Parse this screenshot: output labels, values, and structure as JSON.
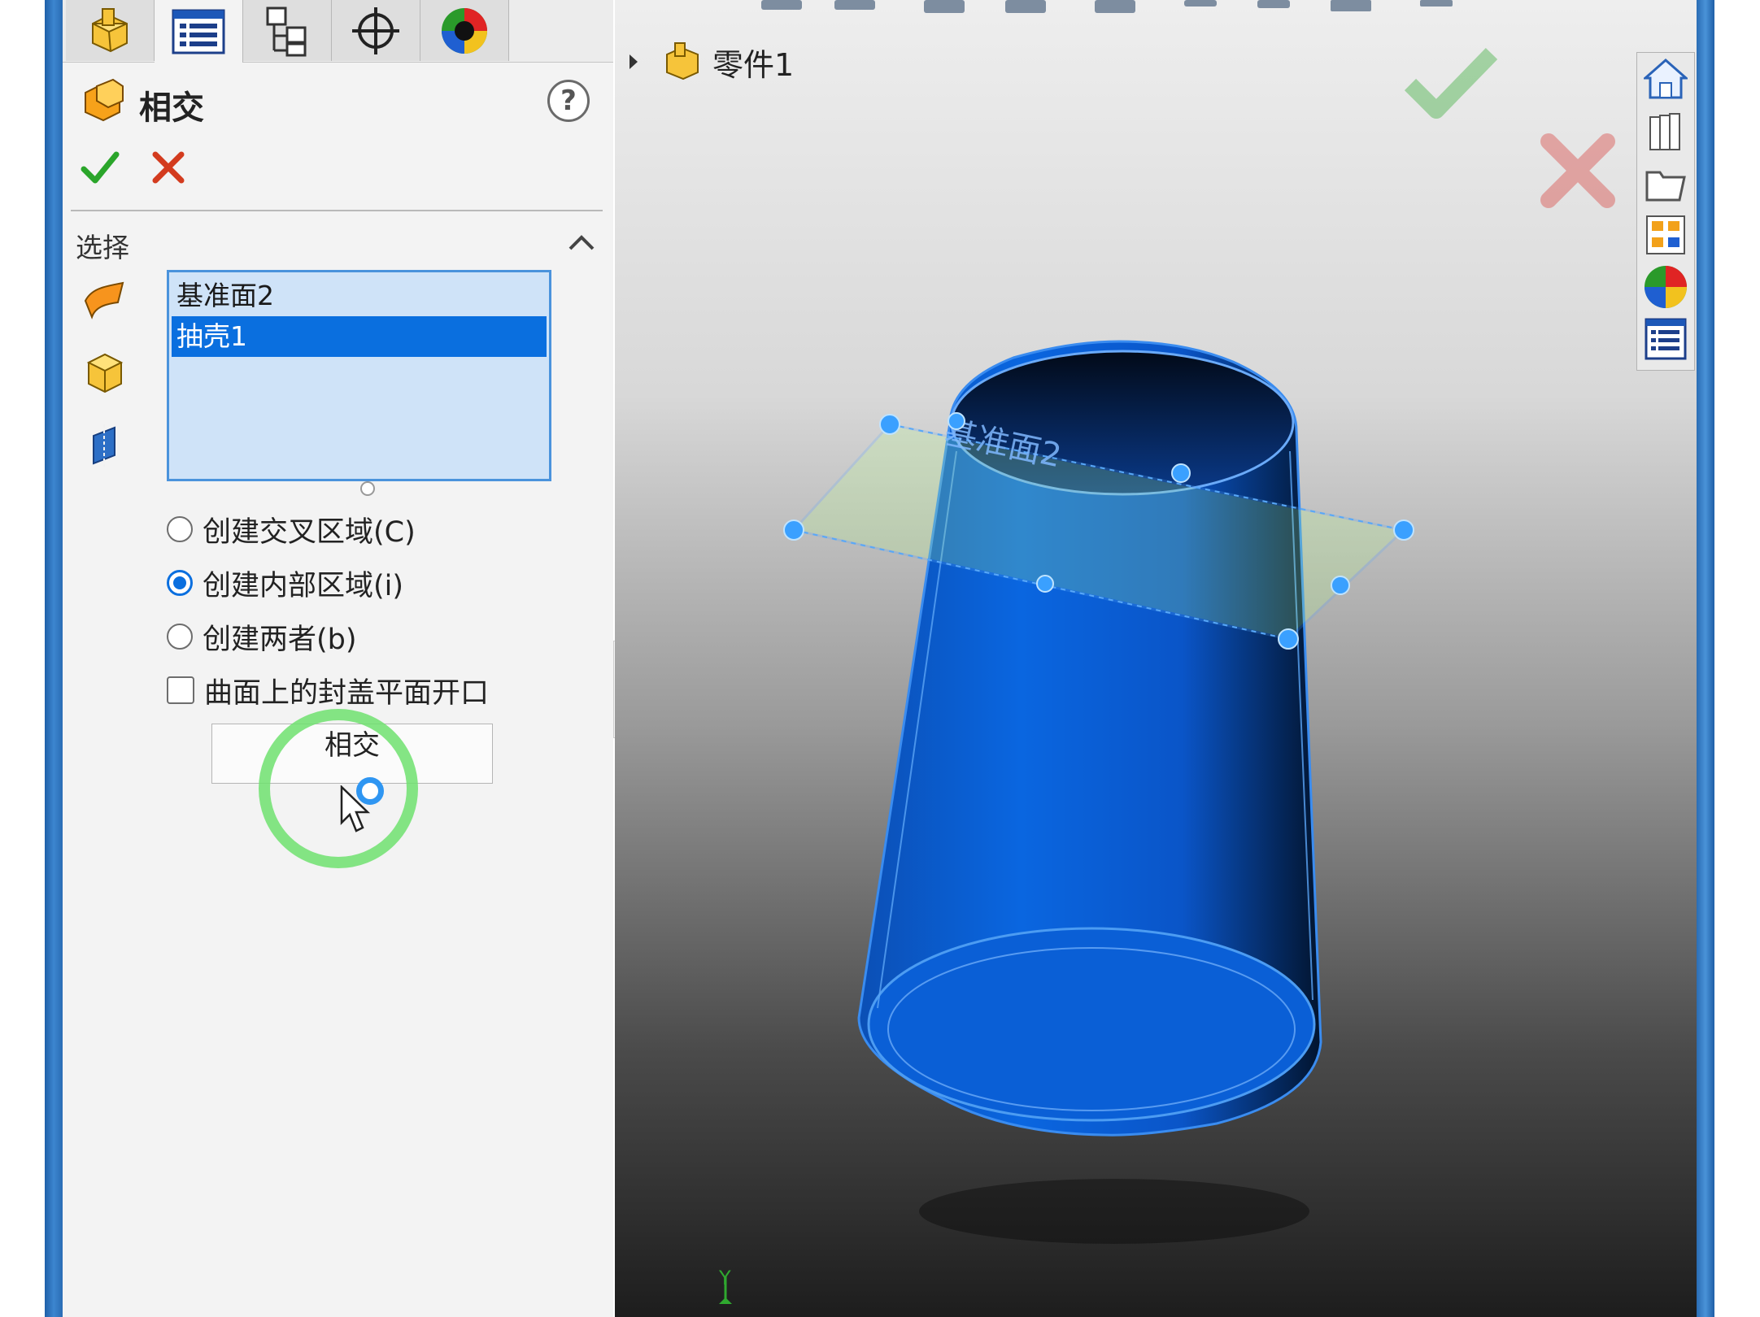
{
  "tabs": [
    {
      "icon": "feature-manager-icon"
    },
    {
      "icon": "property-manager-icon",
      "active": true
    },
    {
      "icon": "configuration-manager-icon"
    },
    {
      "icon": "dimxpert-manager-icon"
    },
    {
      "icon": "display-manager-icon"
    }
  ],
  "property_manager": {
    "title": "相交",
    "help_label": "?"
  },
  "selection": {
    "section_title": "选择",
    "items": [
      {
        "label": "基准面2",
        "selected": false
      },
      {
        "label": "抽壳1",
        "selected": true
      }
    ]
  },
  "options": {
    "radio_create_cross": "创建交叉区域(C)",
    "radio_create_internal": "创建内部区域(i)",
    "radio_create_both": "创建两者(b)",
    "checkbox_cap_planar": "曲面上的封盖平面开口",
    "selected_radio": "创建内部区域(i)",
    "checkbox_checked": false
  },
  "intersect_button": {
    "label": "相交"
  },
  "viewport": {
    "tree_root_label": "零件1",
    "plane_label": "基准面2",
    "axis_label": "Y"
  },
  "colors": {
    "model_blue": "#0a5fd6",
    "selection_blue": "#0a6fdf",
    "ok_green": "#2aa52a",
    "cancel_red": "#d33b1e"
  }
}
